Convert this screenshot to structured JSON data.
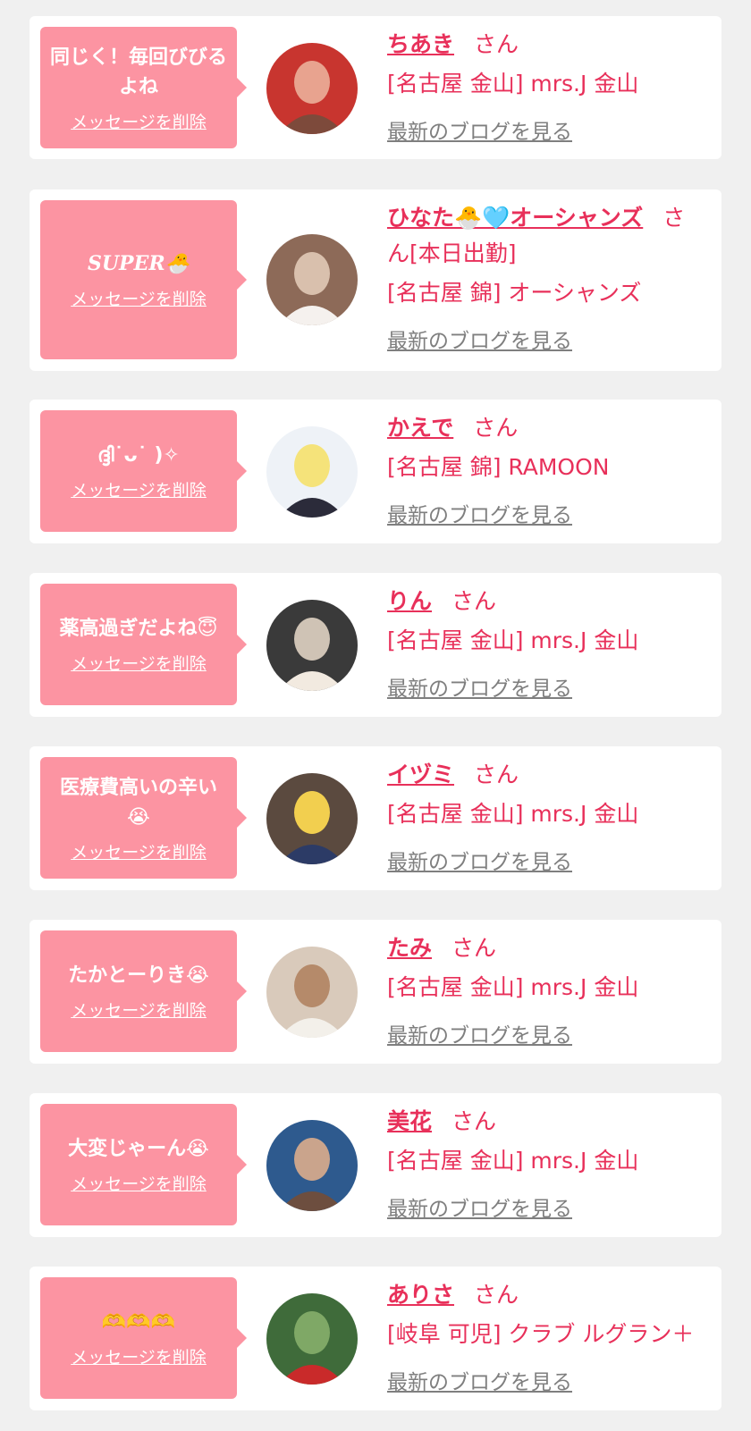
{
  "san_label": "さん",
  "delete_label": "メッセージを削除",
  "blog_label": "最新のブログを見る",
  "colors": {
    "background": "#f0f0f0",
    "card": "#ffffff",
    "bubble": "#fc94a2",
    "accent": "#e8305a",
    "link_gray": "#7f7f7f"
  },
  "entries": [
    {
      "message": "同じく！毎回びびるよね",
      "name": "ちあき",
      "extra": "",
      "shop": "[名古屋 金山] mrs.J 金山",
      "avatar_icon": "avatar-photo-icon"
    },
    {
      "message": "SUPER🐣",
      "name": "ひなた🐣🩵オーシャンズ",
      "extra": "[本日出勤]",
      "shop": "[名古屋 錦] オーシャンズ",
      "avatar_icon": "avatar-photo-icon"
    },
    {
      "message": "ദ്ദി˙ᴗ˙ )✧",
      "name": "かえで",
      "extra": "",
      "shop": "[名古屋 錦] RAMOON",
      "avatar_icon": "avatar-photo-icon"
    },
    {
      "message": "薬高過ぎだよね😇",
      "name": "りん",
      "extra": "",
      "shop": "[名古屋 金山] mrs.J 金山",
      "avatar_icon": "avatar-photo-icon"
    },
    {
      "message": "医療費高いの辛い😭",
      "name": "イヅミ",
      "extra": "",
      "shop": "[名古屋 金山] mrs.J 金山",
      "avatar_icon": "avatar-photo-icon"
    },
    {
      "message": "たかとーりき😭",
      "name": "たみ",
      "extra": "",
      "shop": "[名古屋 金山] mrs.J 金山",
      "avatar_icon": "avatar-photo-icon"
    },
    {
      "message": "大変じゃーん😭",
      "name": "美花",
      "extra": "",
      "shop": "[名古屋 金山] mrs.J 金山",
      "avatar_icon": "avatar-photo-icon"
    },
    {
      "message": "🫶🫶🫶",
      "name": "ありさ",
      "extra": "",
      "shop": "[岐阜 可児] クラブ ルグラン＋",
      "avatar_icon": "avatar-photo-icon"
    }
  ]
}
